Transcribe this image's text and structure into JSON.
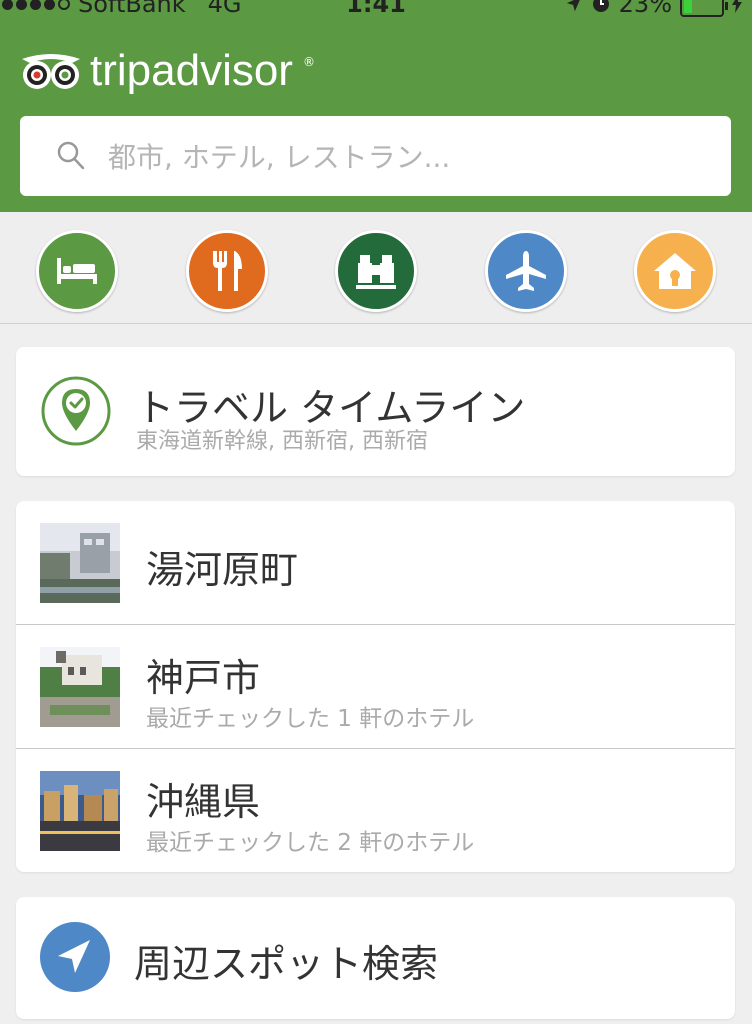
{
  "status_bar": {
    "carrier": "SoftBank",
    "network": "4G",
    "time": "1:41",
    "battery": "23%"
  },
  "header": {
    "logo_text": "tripadvisor",
    "logo_reg": "®"
  },
  "search": {
    "placeholder": "都市, ホテル, レストラン..."
  },
  "categories": [
    {
      "name": "hotels",
      "icon": "bed-icon",
      "color": "#5c9943"
    },
    {
      "name": "restaurants",
      "icon": "fork-knife-icon",
      "color": "#e06a1d"
    },
    {
      "name": "attractions",
      "icon": "binoculars-icon",
      "color": "#246b3b"
    },
    {
      "name": "flights",
      "icon": "airplane-icon",
      "color": "#4f88c6"
    },
    {
      "name": "vacation-rentals",
      "icon": "house-icon",
      "color": "#f6b04d"
    }
  ],
  "travel_timeline": {
    "title": "トラベル タイムライン",
    "subtitle": "東海道新幹線, 西新宿, 西新宿"
  },
  "recent": [
    {
      "name": "湯河原町",
      "sub": ""
    },
    {
      "name": "神戸市",
      "sub": "最近チェックした 1 軒のホテル"
    },
    {
      "name": "沖縄県",
      "sub": "最近チェックした 2 軒のホテル"
    }
  ],
  "nearby": {
    "title": "周辺スポット検索"
  },
  "colors": {
    "brand_green": "#5c9943",
    "location_blue": "#4f88c6"
  }
}
